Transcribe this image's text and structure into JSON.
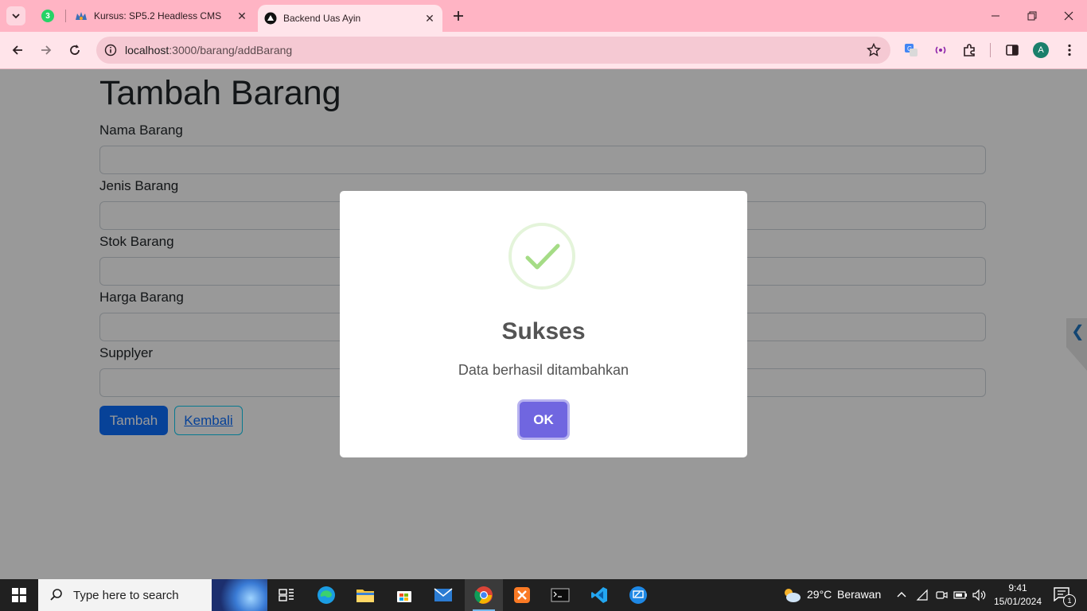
{
  "browser": {
    "pinned_tab_badge": "3",
    "tabs": [
      {
        "title": "Kursus: SP5.2 Headless CMS",
        "active": false
      },
      {
        "title": "Backend Uas Ayin",
        "active": true
      }
    ],
    "url_host": "localhost",
    "url_path": ":3000/barang/addBarang",
    "profile_initial": "A"
  },
  "page": {
    "title": "Tambah Barang",
    "fields": [
      {
        "label": "Nama Barang",
        "value": ""
      },
      {
        "label": "Jenis Barang",
        "value": ""
      },
      {
        "label": "Stok Barang",
        "value": ""
      },
      {
        "label": "Harga Barang",
        "value": ""
      },
      {
        "label": "Supplyer",
        "value": ""
      }
    ],
    "submit_label": "Tambah",
    "back_label": "Kembali"
  },
  "dialog": {
    "title": "Sukses",
    "message": "Data berhasil ditambahkan",
    "confirm_label": "OK",
    "icon": "success-check-icon"
  },
  "taskbar": {
    "search_placeholder": "Type here to search",
    "weather_temp": "29°C",
    "weather_desc": "Berawan",
    "time": "9:41",
    "date": "15/01/2024",
    "notification_count": "1"
  },
  "colors": {
    "tabstrip": "#ffb4c4",
    "toolbar": "#ffe4ea",
    "primary_button": "#0d6efd",
    "dialog_confirm": "#7066e0",
    "success": "#a5dc86"
  }
}
